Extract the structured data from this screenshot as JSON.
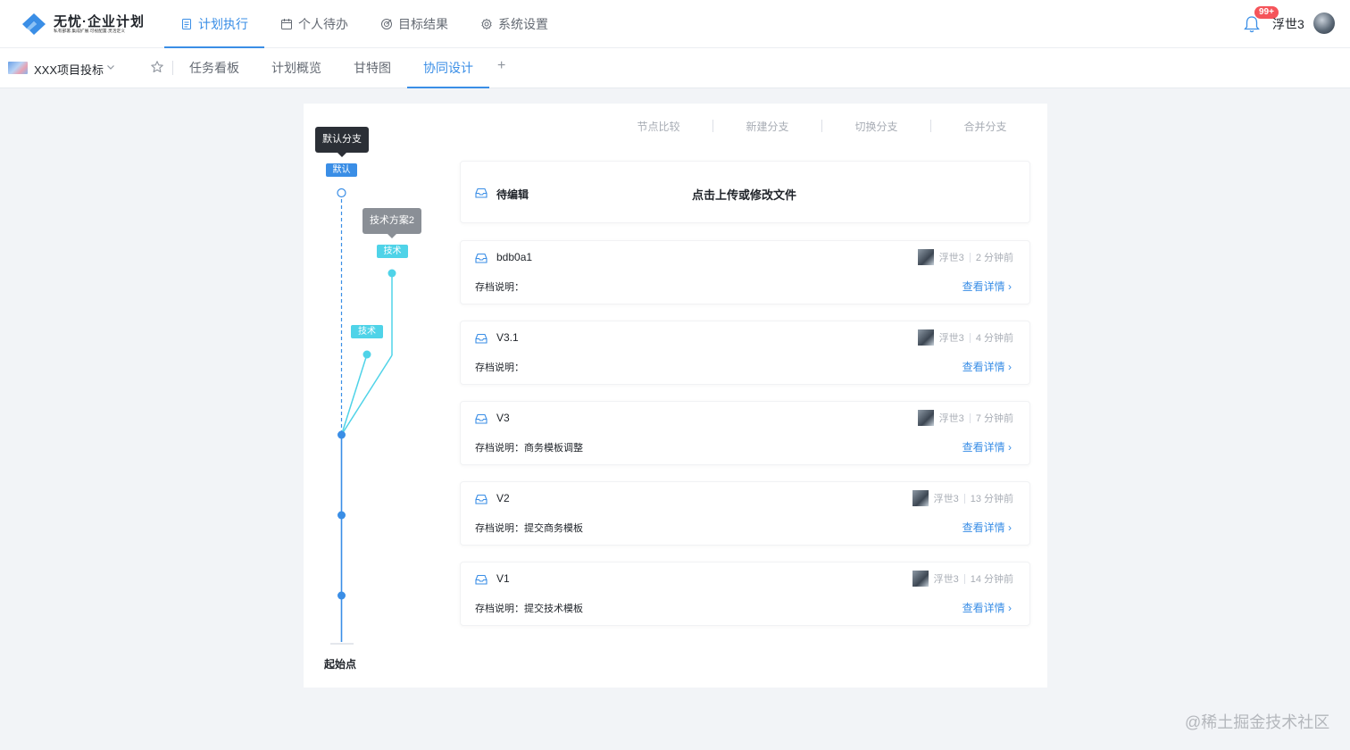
{
  "app": {
    "logo_title": "无忧·企业计划",
    "logo_subtitle": "私有部署.集成扩展.可视配置.灵活定义"
  },
  "top_nav": [
    {
      "label": "计划执行",
      "icon": "document-icon",
      "active": true
    },
    {
      "label": "个人待办",
      "icon": "calendar-icon",
      "active": false
    },
    {
      "label": "目标结果",
      "icon": "target-icon",
      "active": false
    },
    {
      "label": "系统设置",
      "icon": "gear-icon",
      "active": false
    }
  ],
  "user": {
    "name": "浮世3",
    "notification_count": "99+"
  },
  "project": {
    "name": "XXX项目投标"
  },
  "sub_nav": [
    {
      "label": "任务看板",
      "active": false
    },
    {
      "label": "计划概览",
      "active": false
    },
    {
      "label": "甘特图",
      "active": false
    },
    {
      "label": "协同设计",
      "active": true
    }
  ],
  "sub_nav_add": "+",
  "actions": [
    "节点比较",
    "新建分支",
    "切换分支",
    "合并分支"
  ],
  "branch_graph": {
    "tooltip_default": "默认分支",
    "tag_default": "默认",
    "tooltip_tech": "技术方案2",
    "tag_tech_1": "技术",
    "tag_tech_2": "技术",
    "origin_label": "起始点"
  },
  "pending_card": {
    "title": "待编辑",
    "action": "点击上传或修改文件"
  },
  "versions": [
    {
      "title": "bdb0a1",
      "author": "浮世3",
      "time": "2 分钟前",
      "desc": "存档说明：",
      "link": "查看详情"
    },
    {
      "title": "V3.1",
      "author": "浮世3",
      "time": "4 分钟前",
      "desc": "存档说明：",
      "link": "查看详情"
    },
    {
      "title": "V3",
      "author": "浮世3",
      "time": "7 分钟前",
      "desc": "存档说明：商务模板调整",
      "link": "查看详情"
    },
    {
      "title": "V2",
      "author": "浮世3",
      "time": "13 分钟前",
      "desc": "存档说明：提交商务模板",
      "link": "查看详情"
    },
    {
      "title": "V1",
      "author": "浮世3",
      "time": "14 分钟前",
      "desc": "存档说明：提交技术模板",
      "link": "查看详情"
    }
  ],
  "watermark": "@稀土掘金技术社区",
  "colors": {
    "accent": "#3a8ee6",
    "branch_tech": "#4fd3e8",
    "badge": "#f5545a"
  }
}
